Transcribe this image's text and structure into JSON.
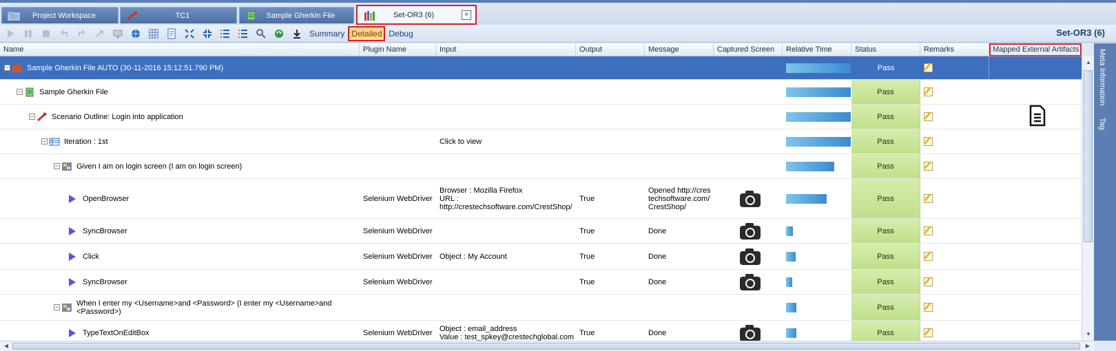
{
  "tabs": [
    {
      "label": "Project Workspace",
      "icon": "folder-icon"
    },
    {
      "label": "TC1",
      "icon": "wrench-icon"
    },
    {
      "label": "Sample Gherkin File",
      "icon": "gherkin-file-icon"
    },
    {
      "label": "Set-OR3 (6)",
      "icon": "books-icon",
      "active": true
    }
  ],
  "tab_close": "×",
  "toolbar": {
    "summary_label": "Summary",
    "detailed_label": "Detailed",
    "debug_label": "Debug",
    "set_title": "Set-OR3 (6)"
  },
  "columns": {
    "name": "Name",
    "plugin": "Plugin Name",
    "input": "Input",
    "output": "Output",
    "message": "Message",
    "captured": "Captured Screen",
    "reltime": "Relative Time",
    "status": "Status",
    "remarks": "Remarks",
    "mapped": "Mapped External Artifacts"
  },
  "rows": [
    {
      "name": "Sample Gherkin File AUTO (30-11-2016 15:12:51.790 PM)",
      "status": "Pass",
      "rel_time": 1.0,
      "selected": true
    },
    {
      "name": "Sample Gherkin File",
      "status": "Pass",
      "rel_time": 1.0
    },
    {
      "name": "Scenario Outline: Login into application",
      "status": "Pass",
      "rel_time": 1.0
    },
    {
      "name": "Iteration : 1st",
      "input": "Click to view",
      "status": "Pass",
      "rel_time": 1.0
    },
    {
      "name": "Given I am on login screen (I am on login screen)",
      "status": "Pass",
      "rel_time": 0.74
    },
    {
      "name": "OpenBrowser",
      "plugin": "Selenium WebDriver",
      "input": "Browser : Mozilla Firefox\nURL : http://crestechsoftware.com/CrestShop/",
      "output": "True",
      "message": "Opened http://crestechsoftware.com/CrestShop/",
      "status": "Pass",
      "rel_time": 0.63
    },
    {
      "name": "SyncBrowser",
      "plugin": "Selenium WebDriver",
      "output": "True",
      "message": "Done",
      "status": "Pass",
      "rel_time": 0.11
    },
    {
      "name": "Click",
      "plugin": "Selenium WebDriver",
      "input": "Object : My Account",
      "output": "True",
      "message": "Done",
      "status": "Pass",
      "rel_time": 0.15
    },
    {
      "name": "SyncBrowser",
      "plugin": "Selenium WebDriver",
      "output": "True",
      "message": "Done",
      "status": "Pass",
      "rel_time": 0.1
    },
    {
      "name": "When I enter my <Username>and <Password> (I enter my <Username>and <Password>)",
      "status": "Pass",
      "rel_time": 0.16
    },
    {
      "name": "TypeTextOnEditBox",
      "plugin": "Selenium WebDriver",
      "input": "Object : email_address\nValue : test_spkey@crestechglobal.com",
      "output": "True",
      "message": "Done",
      "status": "Pass",
      "rel_time": 0.16
    }
  ],
  "side_tabs": [
    "Meta Information",
    "Tag"
  ]
}
